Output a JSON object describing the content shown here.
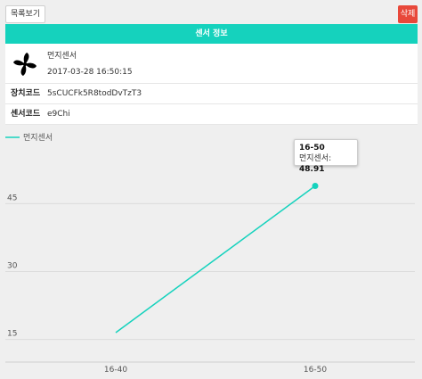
{
  "toolbar": {
    "list_button": "목록보기",
    "delete_button": "삭제"
  },
  "card": {
    "header_title": "센서 정보",
    "icon": "fan-icon",
    "sensor_name": "먼지센서",
    "timestamp": "2017-03-28 16:50:15",
    "device_code_label": "장치코드",
    "device_code_value": "5sCUCFk5R8todDvTzT3",
    "sensor_code_label": "센서코드",
    "sensor_code_value": "e9Chi"
  },
  "colors": {
    "accent": "#15d2bd",
    "delete": "#e8483a"
  },
  "tooltip": {
    "title": "16-50",
    "label": "먼지센서: ",
    "value": "48.91"
  },
  "chart_data": {
    "type": "line",
    "categories": [
      "16-40",
      "16-50"
    ],
    "series": [
      {
        "name": "먼지센서",
        "values": [
          16.5,
          48.91
        ],
        "color": "#15d2bd"
      }
    ],
    "yticks": [
      15,
      30,
      45
    ],
    "ylim": [
      10,
      56.5
    ],
    "grid": true,
    "legend": "top-left"
  }
}
